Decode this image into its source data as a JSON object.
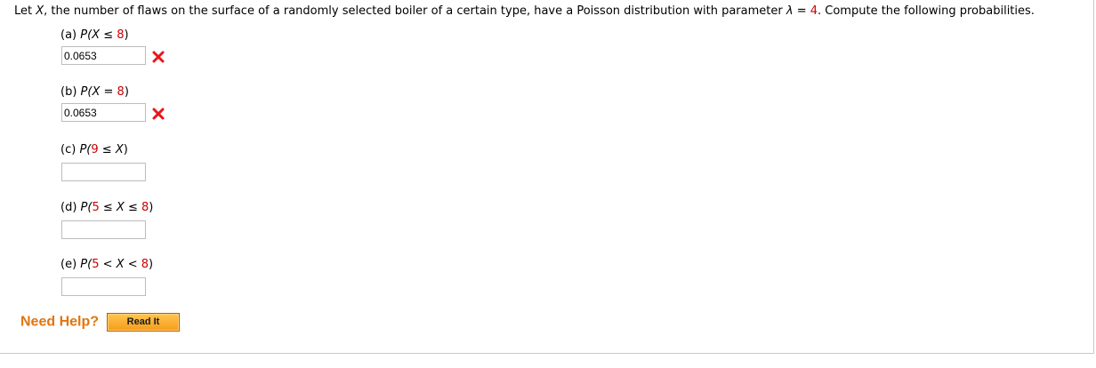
{
  "question": {
    "intro": "Let ",
    "var_x": "X",
    "mid": ", the number of flaws on the surface of a randomly selected boiler of a certain type, have a Poisson distribution with parameter ",
    "lambda": "λ",
    "equals": " = ",
    "lambda_value": "4",
    "outro": ". Compute the following probabilities."
  },
  "parts": [
    {
      "letter": "(a) ",
      "p": "P(",
      "seg1": "X",
      "seg2": " ≤ ",
      "seg3": "8",
      "close": ")",
      "value": "0.0653",
      "status_icon": "x-mark-icon",
      "status": "incorrect"
    },
    {
      "letter": "(b) ",
      "p": "P(",
      "seg1": "X",
      "seg2": " = ",
      "seg3": "8",
      "close": ")",
      "value": "0.0653",
      "status_icon": "x-mark-icon",
      "status": "incorrect"
    },
    {
      "letter": "(c) ",
      "p": "P(",
      "seg1": "9",
      "seg2": " ≤ ",
      "seg3": "X",
      "close": ")",
      "value": ""
    },
    {
      "letter": "(d) ",
      "p": "P(",
      "seg1": "5",
      "seg2": " ≤ ",
      "seg3": "X",
      "seg4": " ≤ ",
      "seg5": "8",
      "close": ")",
      "value": ""
    },
    {
      "letter": "(e) ",
      "p": "P(",
      "seg1": "5",
      "seg2": " < ",
      "seg3": "X",
      "seg4": " < ",
      "seg5": "8",
      "close": ")",
      "value": ""
    }
  ],
  "help": {
    "label": "Need Help?",
    "read_it_label": "Read It"
  },
  "colors": {
    "given_value": "#cc0000",
    "incorrect_mark": "#e8161b",
    "help_label": "#e2740e",
    "read_it_button": "#f7a21c"
  }
}
